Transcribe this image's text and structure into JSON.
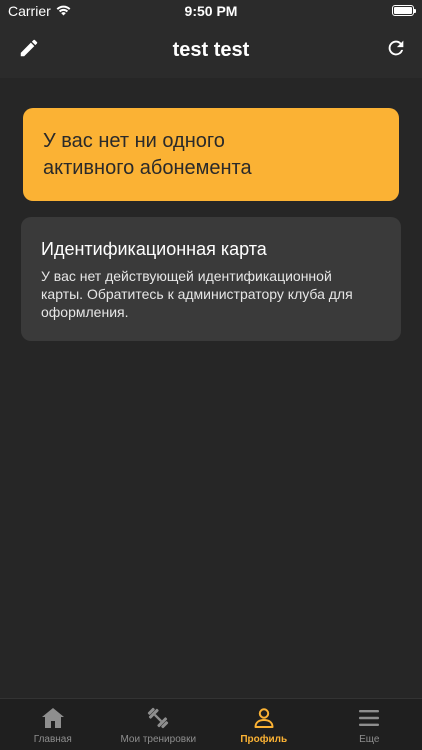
{
  "status_bar": {
    "carrier": "Carrier",
    "time": "9:50 PM"
  },
  "header": {
    "title": "test test",
    "left_icon": "pencil-icon",
    "right_icon": "refresh-icon"
  },
  "subscription_alert": {
    "line1": "У вас нет ни одного",
    "line2": "активного абонемента"
  },
  "id_card": {
    "title": "Идентификационная карта",
    "text_line1": "У вас нет действующей идентификационной",
    "text_line2": "карты. Обратитесь к администратору клуба для",
    "text_line3": "оформления."
  },
  "tabs": [
    {
      "label": "Главная",
      "icon": "home-icon",
      "active": false
    },
    {
      "label": "Мои тренировки",
      "icon": "dumbbell-icon",
      "active": false
    },
    {
      "label": "Профиль",
      "icon": "profile-icon",
      "active": true
    },
    {
      "label": "Еще",
      "icon": "menu-icon",
      "active": false
    }
  ],
  "colors": {
    "accent": "#fbb234",
    "background": "#262626",
    "card": "#3a3a3a",
    "bar": "#2b2b2b",
    "inactive_tab": "#8e8e8e"
  }
}
